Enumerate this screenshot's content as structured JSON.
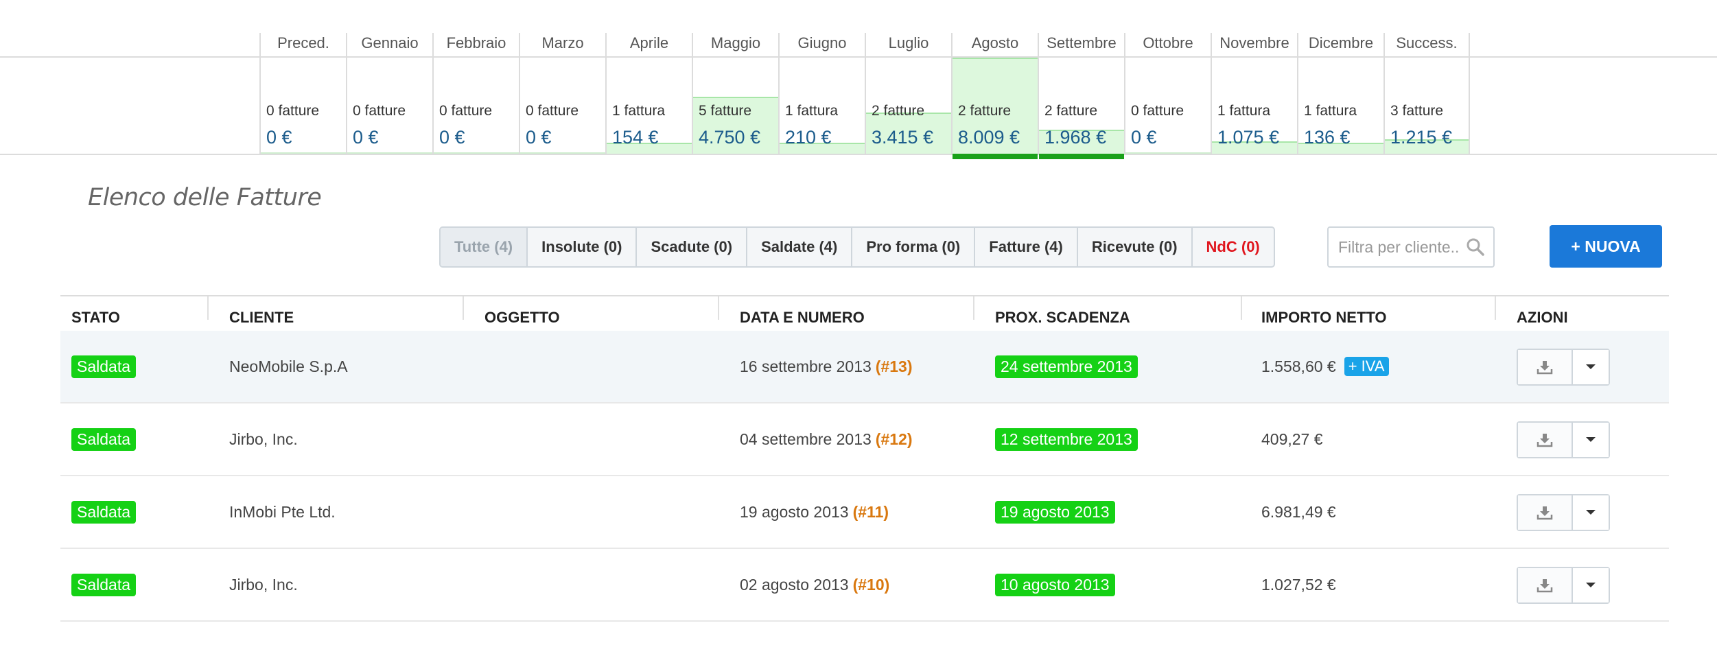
{
  "months": [
    {
      "name": "Preced.",
      "count": "0 fatture",
      "amount": "0 €",
      "level": 0,
      "selected": false
    },
    {
      "name": "Gennaio",
      "count": "0 fatture",
      "amount": "0 €",
      "level": 0,
      "selected": false
    },
    {
      "name": "Febbraio",
      "count": "0 fatture",
      "amount": "0 €",
      "level": 0,
      "selected": false
    },
    {
      "name": "Marzo",
      "count": "0 fatture",
      "amount": "0 €",
      "level": 0,
      "selected": false
    },
    {
      "name": "Aprile",
      "count": "1 fattura",
      "amount": "154 €",
      "level": 0.02,
      "selected": false
    },
    {
      "name": "Maggio",
      "count": "5 fatture",
      "amount": "4.750 €",
      "level": 0.59,
      "selected": false
    },
    {
      "name": "Giugno",
      "count": "1 fattura",
      "amount": "210 €",
      "level": 0.03,
      "selected": false
    },
    {
      "name": "Luglio",
      "count": "2 fatture",
      "amount": "3.415 €",
      "level": 0.43,
      "selected": false
    },
    {
      "name": "Agosto",
      "count": "2 fatture",
      "amount": "8.009 €",
      "level": 1.0,
      "selected": true
    },
    {
      "name": "Settembre",
      "count": "2 fatture",
      "amount": "1.968 €",
      "level": 0.25,
      "selected": true
    },
    {
      "name": "Ottobre",
      "count": "0 fatture",
      "amount": "0 €",
      "level": 0,
      "selected": false
    },
    {
      "name": "Novembre",
      "count": "1 fattura",
      "amount": "1.075 €",
      "level": 0.13,
      "selected": false
    },
    {
      "name": "Dicembre",
      "count": "1 fattura",
      "amount": "136 €",
      "level": 0.02,
      "selected": false
    },
    {
      "name": "Success.",
      "count": "3 fatture",
      "amount": "1.215 €",
      "level": 0.15,
      "selected": false
    }
  ],
  "list": {
    "title": "Elenco delle Fatture"
  },
  "filters": [
    {
      "label": "Tutte (4)",
      "active": true,
      "danger": false
    },
    {
      "label": "Insolute (0)",
      "active": false,
      "danger": false
    },
    {
      "label": "Scadute (0)",
      "active": false,
      "danger": false
    },
    {
      "label": "Saldate (4)",
      "active": false,
      "danger": false
    },
    {
      "label": "Pro forma (0)",
      "active": false,
      "danger": false
    },
    {
      "label": "Fatture (4)",
      "active": false,
      "danger": false
    },
    {
      "label": "Ricevute (0)",
      "active": false,
      "danger": false
    },
    {
      "label": "NdC (0)",
      "active": false,
      "danger": true
    }
  ],
  "search": {
    "placeholder": "Filtra per cliente..",
    "value": ""
  },
  "new_button": {
    "label": "+ NUOVA"
  },
  "table": {
    "columns": [
      "STATO",
      "CLIENTE",
      "OGGETTO",
      "DATA E NUMERO",
      "PROX. SCADENZA",
      "IMPORTO NETTO",
      "AZIONI"
    ],
    "rows": [
      {
        "status": "Saldata",
        "client": "NeoMobile S.p.A",
        "subject": "",
        "date": "16 settembre 2013",
        "number": "(#13)",
        "due": "24 settembre 2013",
        "amount": "1.558,60 €",
        "iva": "+ IVA",
        "highlighted": true
      },
      {
        "status": "Saldata",
        "client": "Jirbo, Inc.",
        "subject": "",
        "date": "04 settembre 2013",
        "number": "(#12)",
        "due": "12 settembre 2013",
        "amount": "409,27 €",
        "iva": "",
        "highlighted": false
      },
      {
        "status": "Saldata",
        "client": "InMobi Pte Ltd.",
        "subject": "",
        "date": "19 agosto 2013",
        "number": "(#11)",
        "due": "19 agosto 2013",
        "amount": "6.981,49 €",
        "iva": "",
        "highlighted": false
      },
      {
        "status": "Saldata",
        "client": "Jirbo, Inc.",
        "subject": "",
        "date": "02 agosto 2013",
        "number": "(#10)",
        "due": "10 agosto 2013",
        "amount": "1.027,52 €",
        "iva": "",
        "highlighted": false
      }
    ]
  },
  "colors": {
    "accent": "#1b79d9",
    "status_green": "#15d115",
    "invoice_number": "#d9780f",
    "iva_badge": "#1aa3e8",
    "danger": "#e0161e",
    "amount_blue": "#1c5c8c"
  },
  "icons": {
    "search": "search-icon",
    "download": "download-icon",
    "dropdown": "caret-down-icon"
  }
}
